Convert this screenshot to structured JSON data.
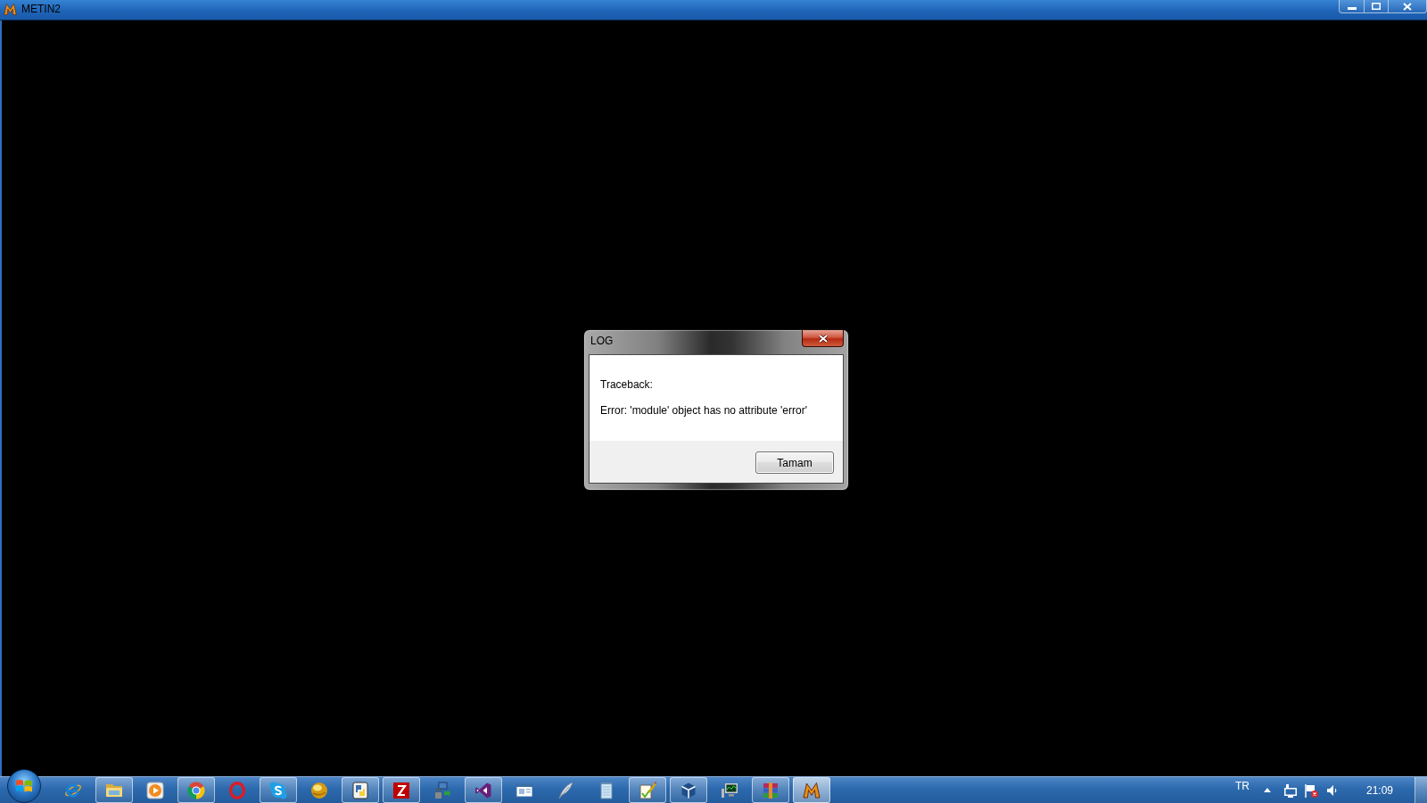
{
  "window": {
    "title": "METIN2"
  },
  "dialog": {
    "title": "LOG",
    "lines": [
      "Traceback:",
      "Error: 'module' object has no attribute 'error'"
    ],
    "button": "Tamam"
  },
  "taskbar": {
    "items": [
      {
        "open": false,
        "selected": false
      },
      {
        "open": true,
        "selected": false
      },
      {
        "open": false,
        "selected": false
      },
      {
        "open": true,
        "selected": false
      },
      {
        "open": false,
        "selected": false
      },
      {
        "open": true,
        "selected": false
      },
      {
        "open": false,
        "selected": false
      },
      {
        "open": true,
        "selected": false
      },
      {
        "open": true,
        "selected": false
      },
      {
        "open": false,
        "selected": false
      },
      {
        "open": true,
        "selected": false
      },
      {
        "open": false,
        "selected": false
      },
      {
        "open": false,
        "selected": false
      },
      {
        "open": false,
        "selected": false
      },
      {
        "open": true,
        "selected": false
      },
      {
        "open": true,
        "selected": false
      },
      {
        "open": false,
        "selected": false
      },
      {
        "open": true,
        "selected": false
      },
      {
        "open": true,
        "selected": true
      }
    ]
  },
  "tray": {
    "language": "TR",
    "clock": "21:09"
  }
}
